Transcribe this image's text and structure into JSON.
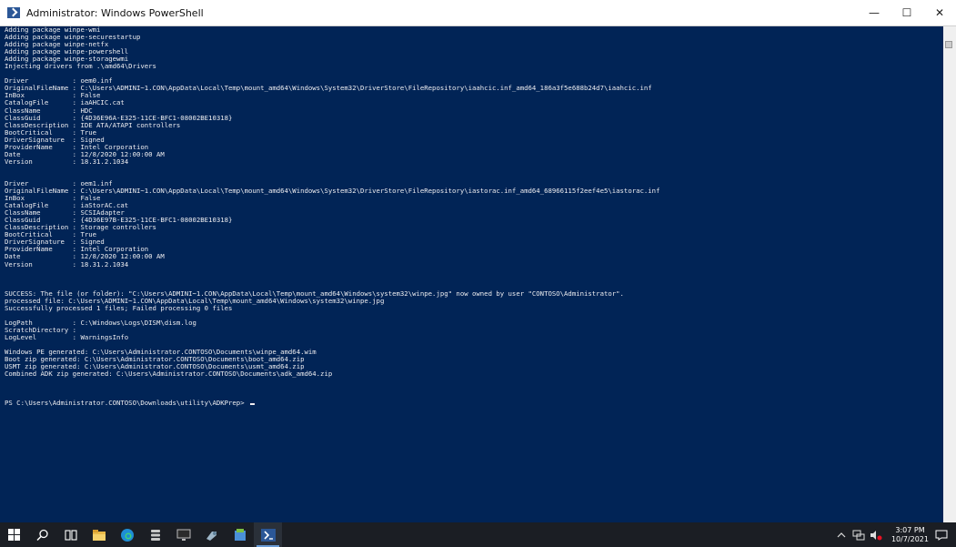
{
  "window": {
    "title": "Administrator: Windows PowerShell",
    "minimize_label": "—",
    "maximize_label": "☐",
    "close_label": "✕"
  },
  "console": {
    "lines": [
      "Adding package winpe-wmi",
      "Adding package winpe-securestartup",
      "Adding package winpe-netfx",
      "Adding package winpe-powershell",
      "Adding package winpe-storagewmi",
      "Injecting drivers from .\\amd64\\Drivers",
      "",
      "Driver           : oem0.inf",
      "OriginalFileName : C:\\Users\\ADMINI~1.CON\\AppData\\Local\\Temp\\mount_amd64\\Windows\\System32\\DriverStore\\FileRepository\\iaahcic.inf_amd64_186a3f5e688b24d7\\iaahcic.inf",
      "InBox            : False",
      "CatalogFile      : iaAHCIC.cat",
      "ClassName        : HDC",
      "ClassGuid        : {4D36E96A-E325-11CE-BFC1-08002BE10318}",
      "ClassDescription : IDE ATA/ATAPI controllers",
      "BootCritical     : True",
      "DriverSignature  : Signed",
      "ProviderName     : Intel Corporation",
      "Date             : 12/8/2020 12:00:00 AM",
      "Version          : 18.31.2.1034",
      "",
      "",
      "Driver           : oem1.inf",
      "OriginalFileName : C:\\Users\\ADMINI~1.CON\\AppData\\Local\\Temp\\mount_amd64\\Windows\\System32\\DriverStore\\FileRepository\\iastorac.inf_amd64_68966115f2eef4e5\\iastorac.inf",
      "InBox            : False",
      "CatalogFile      : iaStorAC.cat",
      "ClassName        : SCSIAdapter",
      "ClassGuid        : {4D36E97B-E325-11CE-BFC1-08002BE10318}",
      "ClassDescription : Storage controllers",
      "BootCritical     : True",
      "DriverSignature  : Signed",
      "ProviderName     : Intel Corporation",
      "Date             : 12/8/2020 12:00:00 AM",
      "Version          : 18.31.2.1034",
      "",
      "",
      "",
      "SUCCESS: The file (or folder): \"C:\\Users\\ADMINI~1.CON\\AppData\\Local\\Temp\\mount_amd64\\Windows\\system32\\winpe.jpg\" now owned by user \"CONTOSO\\Administrator\".",
      "processed file: C:\\Users\\ADMINI~1.CON\\AppData\\Local\\Temp\\mount_amd64\\Windows\\system32\\winpe.jpg",
      "Successfully processed 1 files; Failed processing 0 files",
      "",
      "LogPath          : C:\\Windows\\Logs\\DISM\\dism.log",
      "ScratchDirectory :",
      "LogLevel         : WarningsInfo",
      "",
      "Windows PE generated: C:\\Users\\Administrator.CONTOSO\\Documents\\winpe_amd64.wim",
      "Boot zip generated: C:\\Users\\Administrator.CONTOSO\\Documents\\boot_amd64.zip",
      "USMT zip generated: C:\\Users\\Administrator.CONTOSO\\Documents\\usmt_amd64.zip",
      "Combined ADK zip generated: C:\\Users\\Administrator.CONTOSO\\Documents\\adk_amd64.zip",
      "",
      "",
      ""
    ],
    "prompt": "PS C:\\Users\\Administrator.CONTOSO\\Downloads\\utility\\ADKPrep> "
  },
  "taskbar": {
    "clock_time": "3:07 PM",
    "clock_date": "10/7/2021"
  },
  "colors": {
    "console_bg": "#012456",
    "console_text": "#eeedf0",
    "taskbar_bg": "#1b1e24",
    "accent": "#6a9cd6"
  }
}
